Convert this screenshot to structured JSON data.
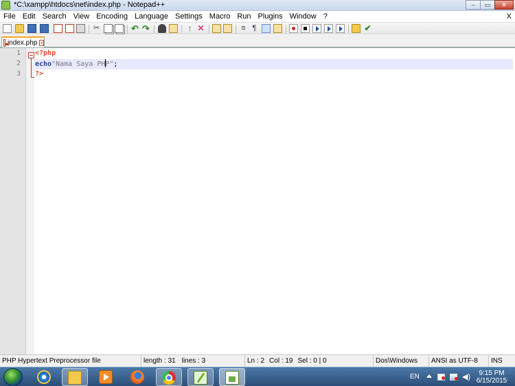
{
  "window": {
    "title": "*C:\\xampp\\htdocs\\net\\index.php - Notepad++",
    "minimize_glyph": "–",
    "maximize_glyph": "▭",
    "close_glyph": "✕"
  },
  "menu": {
    "items": [
      "File",
      "Edit",
      "Search",
      "View",
      "Encoding",
      "Language",
      "Settings",
      "Macro",
      "Run",
      "Plugins",
      "Window",
      "?"
    ],
    "close_label": "X"
  },
  "toolbar": {
    "icons": [
      "new-file-icon",
      "open-file-icon",
      "save-icon",
      "save-all-icon",
      "close-icon",
      "close-all-icon",
      "print-icon",
      "cut-icon",
      "copy-icon",
      "paste-icon",
      "undo-icon",
      "redo-icon",
      "find-icon",
      "replace-icon",
      "zoom-in-icon",
      "zoom-out-icon",
      "sync-v-icon",
      "sync-h-icon",
      "word-wrap-icon",
      "show-all-chars-icon",
      "indent-guide-icon",
      "doc-map-icon",
      "record-macro-icon",
      "stop-record-icon",
      "play-macro-icon",
      "play-multiple-icon",
      "save-macro-icon",
      "folder-workspace-icon",
      "spell-check-icon"
    ]
  },
  "tabs": [
    {
      "label": "index.php",
      "modified": true,
      "active": true
    }
  ],
  "editor": {
    "line_numbers": [
      "1",
      "2",
      "3"
    ],
    "current_line": 2,
    "lines": {
      "l1": "<?php",
      "l2_keyword": "echo",
      "l2_string_a": "\"Nama Saya PH",
      "l2_string_b": "P\"",
      "l2_end": ";",
      "l3": "?>"
    }
  },
  "status": {
    "language": "PHP Hypertext Preprocessor file",
    "length": "length : 31",
    "lines": "lines : 3",
    "ln": "Ln : 2",
    "col": "Col : 19",
    "sel": "Sel : 0 | 0",
    "eol": "Dos\\Windows",
    "encoding": "ANSI as UTF-8",
    "mode": "INS"
  },
  "taskbar": {
    "apps": [
      "internet-explorer",
      "windows-explorer",
      "media-player",
      "firefox",
      "chrome",
      "notepad-plus-plus",
      "notepad-plus-plus-active"
    ],
    "language": "EN",
    "time": "9:15 PM",
    "date": "6/15/2015",
    "volume_glyph": "◀)"
  },
  "colors": {
    "php_tag": "#e34a2d",
    "keyword": "#1f3fa0",
    "string": "#7a7a7a",
    "current_line": "#e8e8ff",
    "tab_accent": "#f5a623"
  }
}
